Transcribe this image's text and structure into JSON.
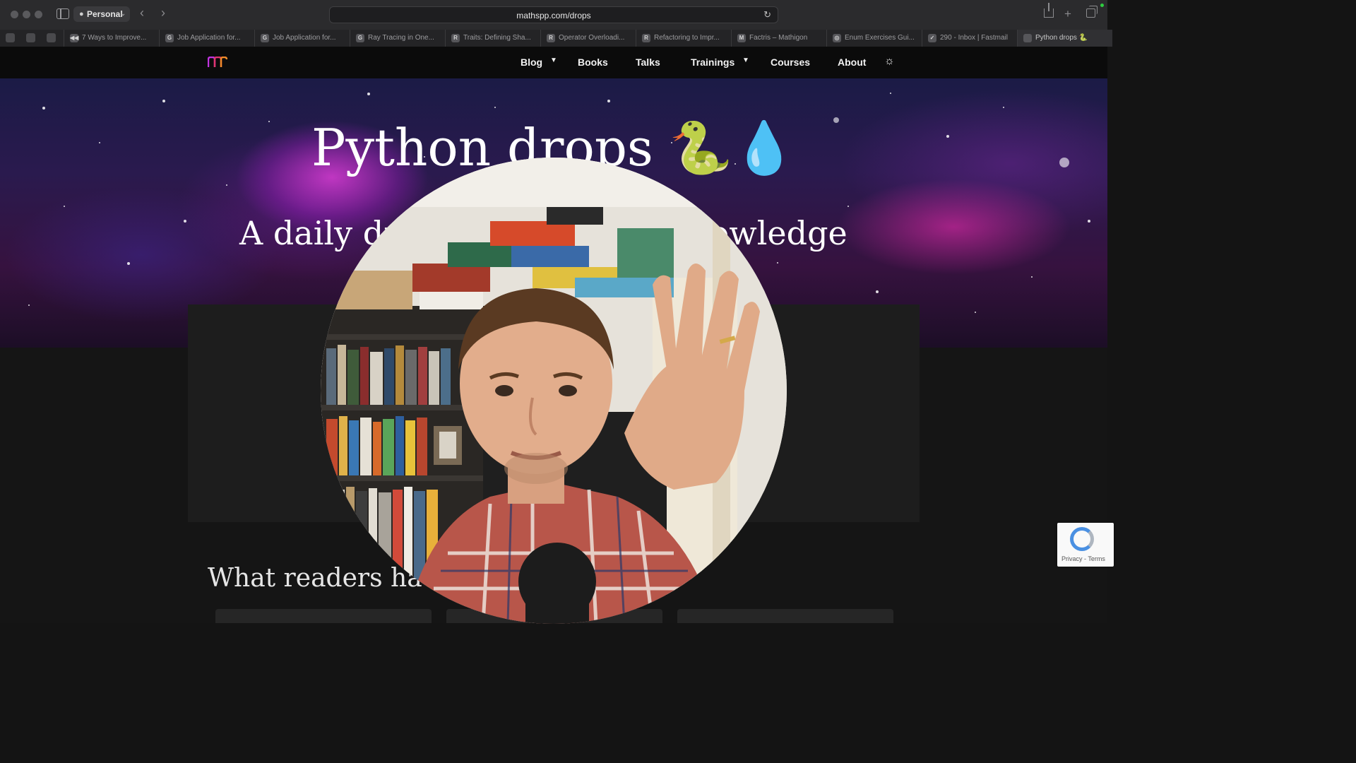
{
  "browser": {
    "profile_label": "Personal",
    "url": "mathspp.com/drops",
    "tabs": [
      {
        "favicon": "◀◀",
        "title": "7 Ways to Improve...",
        "active": false
      },
      {
        "favicon": "G",
        "title": "Job Application for...",
        "active": false
      },
      {
        "favicon": "G",
        "title": "Job Application for...",
        "active": false
      },
      {
        "favicon": "G",
        "title": "Ray Tracing in One...",
        "active": false
      },
      {
        "favicon": "R",
        "title": "Traits: Defining Sha...",
        "active": false
      },
      {
        "favicon": "R",
        "title": "Operator Overloadi...",
        "active": false
      },
      {
        "favicon": "R",
        "title": "Refactoring to Impr...",
        "active": false
      },
      {
        "favicon": "M",
        "title": "Factris – Mathigon",
        "active": false
      },
      {
        "favicon": "◎",
        "title": "Enum Exercises Gui...",
        "active": false
      },
      {
        "favicon": "✓",
        "title": "290 - Inbox | Fastmail",
        "active": false
      },
      {
        "favicon": "",
        "title": "Python drops 🐍",
        "active": true
      }
    ]
  },
  "site": {
    "nav": {
      "blog": "Blog",
      "books": "Books",
      "talks": "Talks",
      "trainings": "Trainings",
      "courses": "Courses",
      "about": "About"
    },
    "theme_toggle_icon": "sun-icon",
    "hero": {
      "title": "Python drops 🐍💧",
      "subtitle_left": "A daily dr",
      "subtitle_right": "nowledge"
    },
    "readers_heading": "What readers ha"
  },
  "recaptcha": {
    "links": "Privacy - Terms"
  },
  "colors": {
    "hero_purple": "#d63cd2",
    "hero_pink": "#d228a0",
    "nav_bg": "#0b0b0b",
    "page_bg": "#151515"
  },
  "icons": [
    "sidebar-toggle-icon",
    "person-icon",
    "back-arrow-icon",
    "forward-arrow-icon",
    "reload-icon",
    "share-icon",
    "new-tab-icon",
    "tab-overview-icon",
    "sun-icon",
    "recaptcha-logo-icon"
  ]
}
